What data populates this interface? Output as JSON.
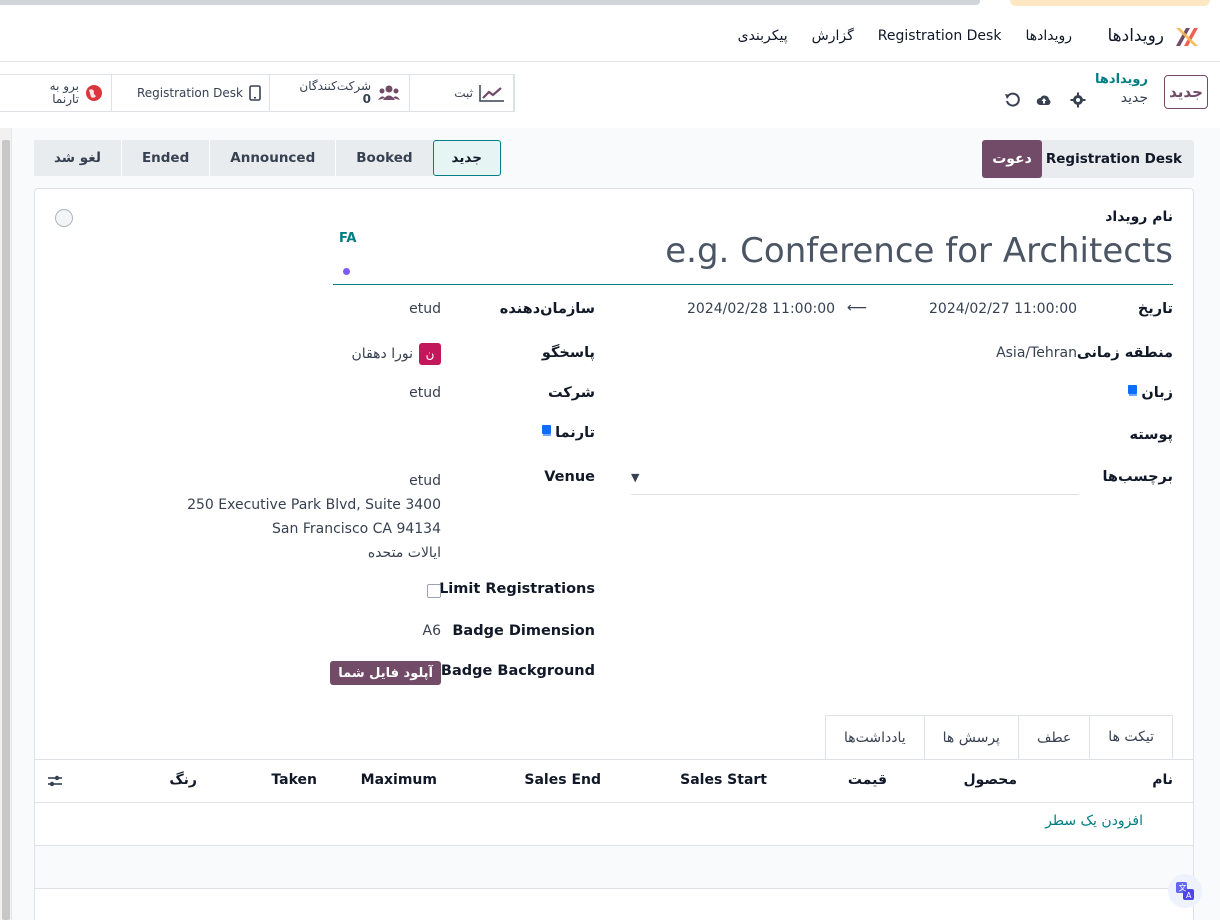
{
  "app": {
    "name": "رویدادها",
    "brand_color": "#714b67",
    "link_color": "#017e84"
  },
  "navbar": {
    "menu": [
      "رویدادها",
      "Registration Desk",
      "گزارش",
      "پیکربندی"
    ]
  },
  "control": {
    "new_label": "جدید",
    "breadcrumb_parent": "رویدادها",
    "breadcrumb_current": "جدید",
    "icons": [
      "gear-icon",
      "cloud-upload-icon",
      "discard-icon"
    ]
  },
  "smart_buttons": [
    {
      "label": "ثبت",
      "icon": "chart-line-icon"
    },
    {
      "label": "شرکت‌کنندگان",
      "count": "0",
      "icon": "users-icon"
    },
    {
      "label": "Registration Desk",
      "icon": "mobile-icon"
    },
    {
      "label": "برو به",
      "sublabel": "تارنما",
      "icon": "globe-icon"
    }
  ],
  "statusbar": {
    "stages": [
      "لغو شد",
      "Ended",
      "Announced",
      "Booked",
      "جدید"
    ],
    "active_stage": "جدید",
    "btn_registration_desk": "Registration Desk",
    "btn_invite": "دعوت"
  },
  "form": {
    "event_name_label": "نام رویداد",
    "event_name_placeholder": "e.g. Conference for Architects",
    "lang_code": "FA",
    "date_label": "تاریخ",
    "date_start": "2024/02/27 11:00:00",
    "date_end": "2024/02/28 11:00:00",
    "timezone_label": "منطقه زمانی",
    "timezone_value": "Asia/Tehran",
    "language_label": "زبان",
    "template_label": "پوسته",
    "tags_label": "برچسب‌ها",
    "organizer_label": "سازمان‌دهنده",
    "organizer_value": "etud",
    "responsible_label": "پاسخگو",
    "responsible_value": "نورا دهقان",
    "responsible_initial": "ن",
    "company_label": "شرکت",
    "company_value": "etud",
    "website_label": "تارنما",
    "venue_label": "Venue",
    "venue_lines": [
      "etud",
      "250 Executive Park Blvd, Suite 3400",
      "San Francisco CA 94134",
      "ایالات متحده"
    ],
    "limit_label": "Limit Registrations",
    "badge_dim_label": "Badge Dimension",
    "badge_dim_value": "A6",
    "badge_bg_label": "Badge Background",
    "upload_label": "آپلود فایل شما"
  },
  "notebook": {
    "tabs": [
      "تیکت ها",
      "عطف",
      "پرسش ها",
      "یادداشت‌ها"
    ],
    "active_tab": "تیکت ها",
    "columns": [
      "نام",
      "محصول",
      "قیمت",
      "Sales Start",
      "Sales End",
      "Maximum",
      "Taken",
      "رنگ"
    ],
    "add_line": "افزودن یک سطر"
  }
}
